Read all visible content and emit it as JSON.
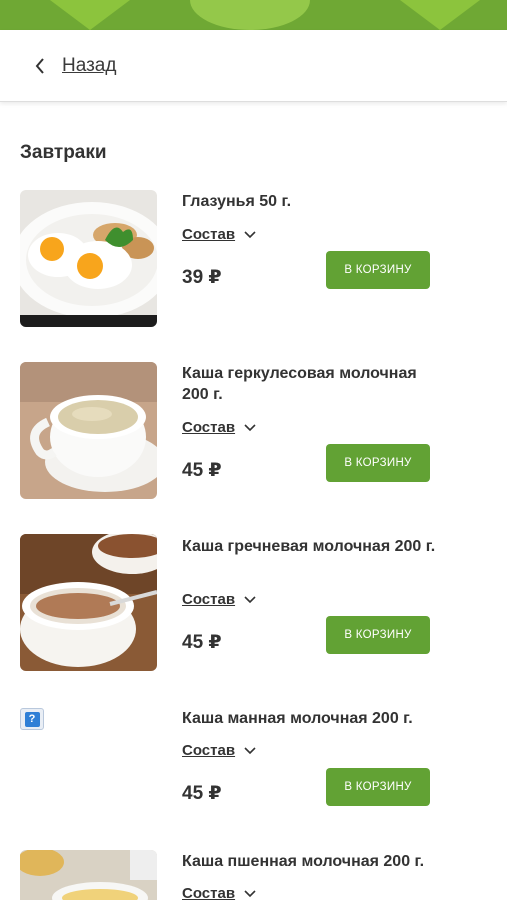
{
  "header": {
    "back_label": "Назад"
  },
  "section": {
    "title": "Завтраки"
  },
  "colors": {
    "accent": "#62a234",
    "banner": "#6fa834"
  },
  "products": [
    {
      "name": "Глазунья 50 г.",
      "composition_label": "Состав",
      "price": "39 ₽",
      "button_label": "В КОРЗИНУ",
      "image": "fried-eggs"
    },
    {
      "name": "Каша геркулесовая молочная 200 г.",
      "composition_label": "Состав",
      "price": "45 ₽",
      "button_label": "В КОРЗИНУ",
      "image": "oatmeal"
    },
    {
      "name": "Каша гречневая молочная 200 г.",
      "composition_label": "Состав",
      "price": "45 ₽",
      "button_label": "В КОРЗИНУ",
      "image": "buckwheat"
    },
    {
      "name": "Каша манная молочная 200 г.",
      "composition_label": "Состав",
      "price": "45 ₽",
      "button_label": "В КОРЗИНУ",
      "image": "broken-image"
    },
    {
      "name": "Каша пшенная молочная 200 г.",
      "composition_label": "Состав",
      "image": "millet"
    }
  ]
}
